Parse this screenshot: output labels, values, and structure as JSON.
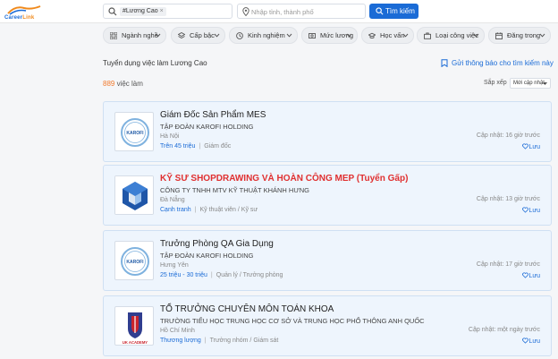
{
  "header": {
    "logo_text_a": "Career",
    "logo_text_b": "Link",
    "keyword_chip": "#Lương Cao",
    "location_placeholder": "Nhập tỉnh, thành phố",
    "search_button": "Tìm kiếm"
  },
  "filters": [
    {
      "label": "Ngành nghề",
      "icon": "grid-icon"
    },
    {
      "label": "Cấp bậc",
      "icon": "layers-icon"
    },
    {
      "label": "Kinh nghiệm",
      "icon": "experience-icon"
    },
    {
      "label": "Mức lương",
      "icon": "money-icon"
    },
    {
      "label": "Học vấn",
      "icon": "graduation-cap-icon"
    },
    {
      "label": "Loại công việc",
      "icon": "briefcase-icon"
    },
    {
      "label": "Đăng trong",
      "icon": "calendar-icon"
    }
  ],
  "results": {
    "page_title": "Tuyển dụng việc làm Lương Cao",
    "notify_label": "Gửi thông báo cho tìm kiếm này",
    "count_number": "889",
    "count_label": " việc làm",
    "sort_label": "Sắp xếp",
    "sort_value": "Mới cập nhật"
  },
  "jobs": [
    {
      "title": "Giám Đốc Sản Phẩm MES",
      "company": "TẬP ĐOÀN KAROFI HOLDING",
      "location": "Hà Nội",
      "salary": "Trên 45 triệu",
      "level": "Giám đốc",
      "updated": "Cập nhật: 16 giờ trước",
      "save": "Lưu",
      "logo_text": "KAROFI",
      "hot": false
    },
    {
      "title": "KỸ SƯ SHOPDRAWING VÀ HOÀN CÔNG MEP (Tuyển Gấp)",
      "company": "CÔNG TY TNHH MTV KỸ THUẬT KHÁNH HƯNG",
      "location": "Đà Nẵng",
      "salary": "Cạnh tranh",
      "level": "Kỹ thuật viên / Kỹ sư",
      "updated": "Cập nhật: 13 giờ trước",
      "save": "Lưu",
      "logo_text": "",
      "hot": true
    },
    {
      "title": "Trưởng Phòng QA Gia Dụng",
      "company": "TẬP ĐOÀN KAROFI HOLDING",
      "location": "Hưng Yên",
      "salary": "25 triệu - 30 triệu",
      "level": "Quản lý / Trưởng phòng",
      "updated": "Cập nhật: 17 giờ trước",
      "save": "Lưu",
      "logo_text": "KAROFI",
      "hot": false
    },
    {
      "title": "TỔ TRƯỞNG CHUYÊN MÔN TOÁN KHOA",
      "company": "TRƯỜNG TIỂU HỌC TRUNG HỌC CƠ SỞ VÀ TRUNG HỌC PHỔ THÔNG ANH QUỐC",
      "location": "Hồ Chí Minh",
      "salary": "Thương lượng",
      "level": "Trưởng nhóm / Giám sát",
      "updated": "Cập nhật: một ngày trước",
      "save": "Lưu",
      "logo_text": "UK ACADEMY",
      "hot": false
    }
  ],
  "colors": {
    "accent": "#1a6bd6",
    "hot_title": "#e03030",
    "count_number": "#f27a2e",
    "card_bg": "#eef5fd"
  }
}
